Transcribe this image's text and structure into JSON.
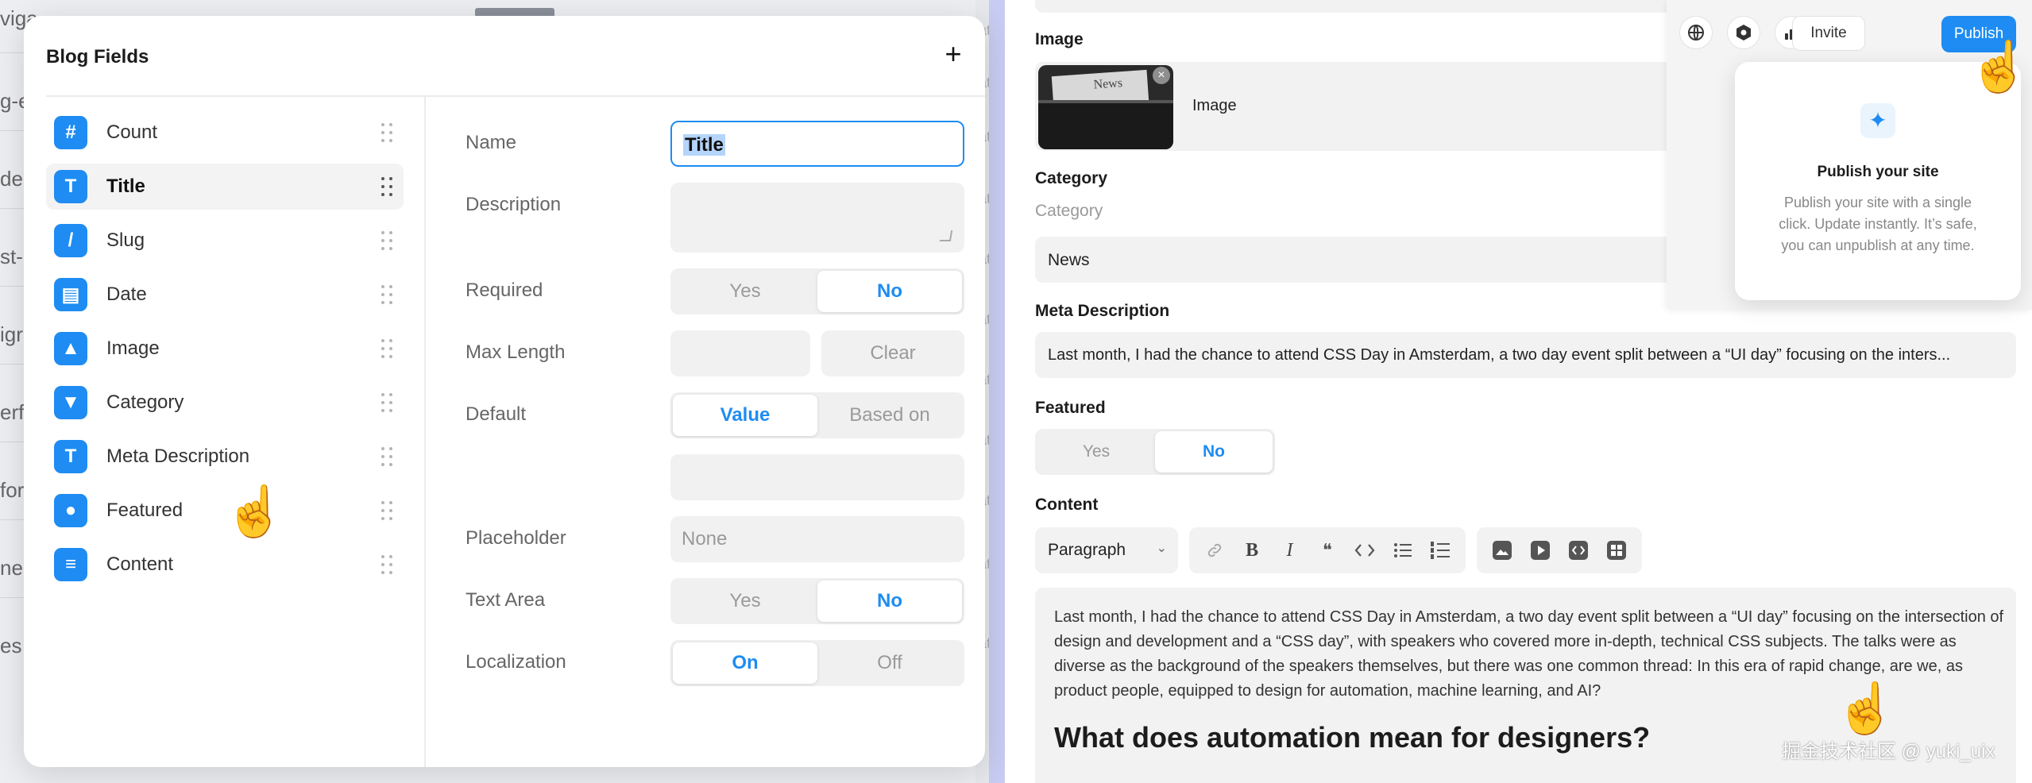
{
  "backdrop": {
    "stubs": [
      "viga",
      "g-e",
      "de-",
      "st-",
      "igr",
      "erf",
      "for",
      "ner",
      "es"
    ],
    "col_stub": "atte"
  },
  "modal": {
    "title": "Blog Fields",
    "add_icon": "plus-icon",
    "fields": [
      {
        "label": "Count",
        "icon": "hash-icon",
        "glyph": "#"
      },
      {
        "label": "Title",
        "icon": "text-icon",
        "glyph": "T",
        "active": true
      },
      {
        "label": "Slug",
        "icon": "slash-icon",
        "glyph": "/"
      },
      {
        "label": "Date",
        "icon": "calendar-icon",
        "glyph": "▤"
      },
      {
        "label": "Image",
        "icon": "image-icon",
        "glyph": "▲"
      },
      {
        "label": "Category",
        "icon": "dropdown-icon",
        "glyph": "▼"
      },
      {
        "label": "Meta Description",
        "icon": "text-icon",
        "glyph": "T"
      },
      {
        "label": "Featured",
        "icon": "toggle-icon",
        "glyph": "●"
      },
      {
        "label": "Content",
        "icon": "paragraph-icon",
        "glyph": "≡"
      }
    ],
    "settings": {
      "name_label": "Name",
      "name_value": "Title",
      "description_label": "Description",
      "required_label": "Required",
      "required_options": [
        "Yes",
        "No"
      ],
      "required_selected": "No",
      "maxlength_label": "Max Length",
      "clear_label": "Clear",
      "default_label": "Default",
      "default_options": [
        "Value",
        "Based on"
      ],
      "default_selected": "Value",
      "placeholder_label": "Placeholder",
      "placeholder_value": "None",
      "textarea_label": "Text Area",
      "textarea_options": [
        "Yes",
        "No"
      ],
      "textarea_selected": "No",
      "localization_label": "Localization",
      "localization_options": [
        "On",
        "Off"
      ],
      "localization_selected": "On"
    }
  },
  "editor": {
    "image_label": "Image",
    "image_name": "Image",
    "thumb_text": "News",
    "category_label": "Category",
    "category_sub": "Category",
    "category_value": "News",
    "meta_label": "Meta Description",
    "meta_value": "Last month, I had the chance to attend CSS Day in Amsterdam, a two day event split between a “UI day” focusing on the inters...",
    "featured_label": "Featured",
    "featured_options": [
      "Yes",
      "No"
    ],
    "featured_selected": "No",
    "content_label": "Content",
    "toolbar": {
      "paragraph_label": "Paragraph",
      "format_icons": [
        "link-icon",
        "bold-icon",
        "italic-icon",
        "quote-icon",
        "code-icon",
        "bullet-list-icon",
        "numbered-list-icon"
      ],
      "media_icons": [
        "image-icon",
        "video-icon",
        "embed-icon",
        "component-icon"
      ]
    },
    "content_paragraph": "Last month, I had the chance to attend CSS Day in Amsterdam, a two day event split between a “UI day” focusing on the intersection of design and development and a “CSS day”, with speakers who covered more in-depth, technical CSS subjects. The talks were as diverse as the background of the speakers themselves, but there was one common thread: In this era of rapid change, are we, as product people, equipped to design for automation, machine learning, and AI?",
    "content_heading": "What does automation mean for designers?"
  },
  "header": {
    "invite_label": "Invite",
    "publish_label": "Publish"
  },
  "popover": {
    "title": "Publish your site",
    "body": "Publish your site with a single click. Update instantly. It’s safe, you can unpublish at any time."
  },
  "watermark": "掘金技术社区 @ yuki_uix",
  "colors": {
    "accent": "#1e8cf2",
    "cursor_outline": "#6b73d8"
  }
}
